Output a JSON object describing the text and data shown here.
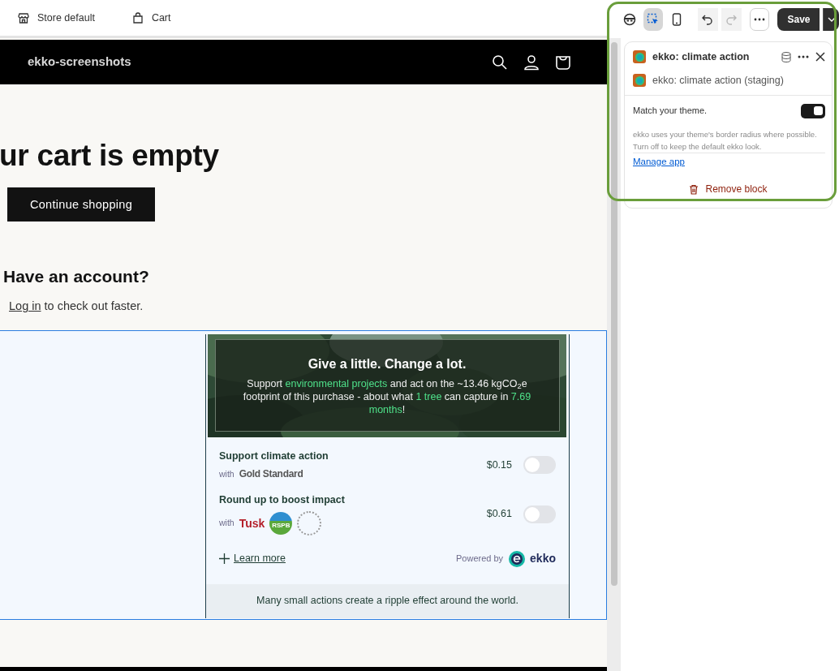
{
  "topbar": {
    "store_label": "Store default",
    "page_label": "Cart"
  },
  "editor_tools": [
    {
      "kind": "inspector",
      "selected": false,
      "disabled": false
    },
    {
      "kind": "select",
      "selected": true,
      "disabled": false
    },
    {
      "kind": "mobile",
      "selected": false,
      "disabled": false
    },
    {
      "kind": "undo",
      "selected": false,
      "disabled": false
    },
    {
      "kind": "redo",
      "selected": false,
      "disabled": true
    },
    {
      "kind": "more",
      "selected": false,
      "disabled": false
    }
  ],
  "save_button": {
    "label": "Save"
  },
  "store_header": {
    "brand": "ekko-screenshots"
  },
  "cart": {
    "heading": "ur cart is empty",
    "continue_button": "Continue shopping",
    "account_heading": "Have an account?",
    "login_link": "Log in",
    "login_rest": " to check out faster."
  },
  "widget": {
    "title": "Give a little. Change a lot.",
    "body": [
      {
        "text": "Support ",
        "highlight": false
      },
      {
        "text": "environmental projects",
        "highlight": true
      },
      {
        "text": " and act on the ~13.46 kgCO$_{2}$e footprint of this purchase - about what ",
        "highlight": false
      },
      {
        "text": "1 tree",
        "highlight": true
      },
      {
        "text": " can capture in ",
        "highlight": false
      },
      {
        "text": "7.69 months",
        "highlight": true
      },
      {
        "text": "!",
        "highlight": false
      }
    ],
    "options": [
      {
        "title": "Support climate action",
        "with": "with",
        "partners": [
          {
            "kind": "goldstandard",
            "text": "Gold Standard"
          }
        ],
        "price": "$0.15",
        "on": false
      },
      {
        "title": "Round up to boost impact",
        "with": "with",
        "partners": [
          {
            "kind": "tusk",
            "text": "Tusk"
          },
          {
            "kind": "rspb",
            "text": "RSPB"
          },
          {
            "kind": "ring"
          }
        ],
        "price": "$0.61",
        "on": false
      }
    ],
    "learn_more": "Learn more",
    "powered_by": "Powered by",
    "logo_text": "ekko",
    "footer": "Many small actions create a ripple effect around the world."
  },
  "panel": {
    "block_title": "ekko: climate action",
    "app_name": "ekko: climate action (staging)",
    "setting_label": "Match your theme.",
    "setting_on": true,
    "setting_help": "ekko uses your theme's border radius where possible. Turn off to keep the default ekko look.",
    "manage_link": "Manage app",
    "remove_label": "Remove block"
  }
}
